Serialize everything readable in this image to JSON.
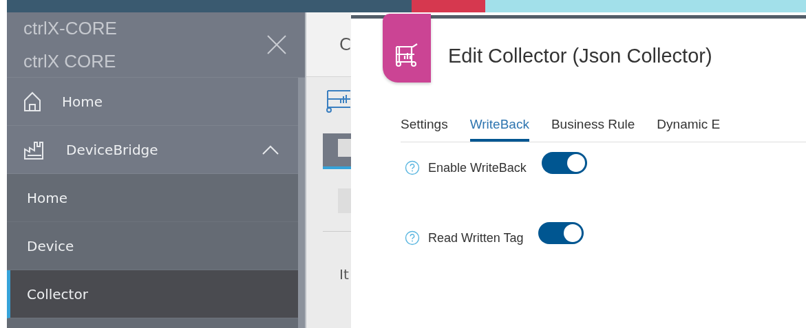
{
  "sidebar": {
    "titles": [
      "ctrlX-CORE",
      "ctrlX CORE"
    ],
    "items": [
      {
        "label": "Home",
        "kind": "top",
        "selected": false
      },
      {
        "label": "DeviceBridge",
        "kind": "group",
        "expanded": true,
        "selected": false,
        "children": [
          {
            "label": "Home",
            "selected": false
          },
          {
            "label": "Device",
            "selected": false
          },
          {
            "label": "Collector",
            "selected": true
          }
        ]
      }
    ]
  },
  "background": {
    "title": "C",
    "text": "It"
  },
  "dialog": {
    "title": "Edit Collector (Json Collector)",
    "tabs": [
      {
        "label": "Settings",
        "selected": false
      },
      {
        "label": "WriteBack",
        "selected": true
      },
      {
        "label": "Business Rule",
        "selected": false
      },
      {
        "label": "Dynamic E",
        "selected": false
      }
    ],
    "settings": [
      {
        "label": "Enable WriteBack",
        "on": true
      },
      {
        "label": "Read Written Tag",
        "on": true
      }
    ]
  }
}
